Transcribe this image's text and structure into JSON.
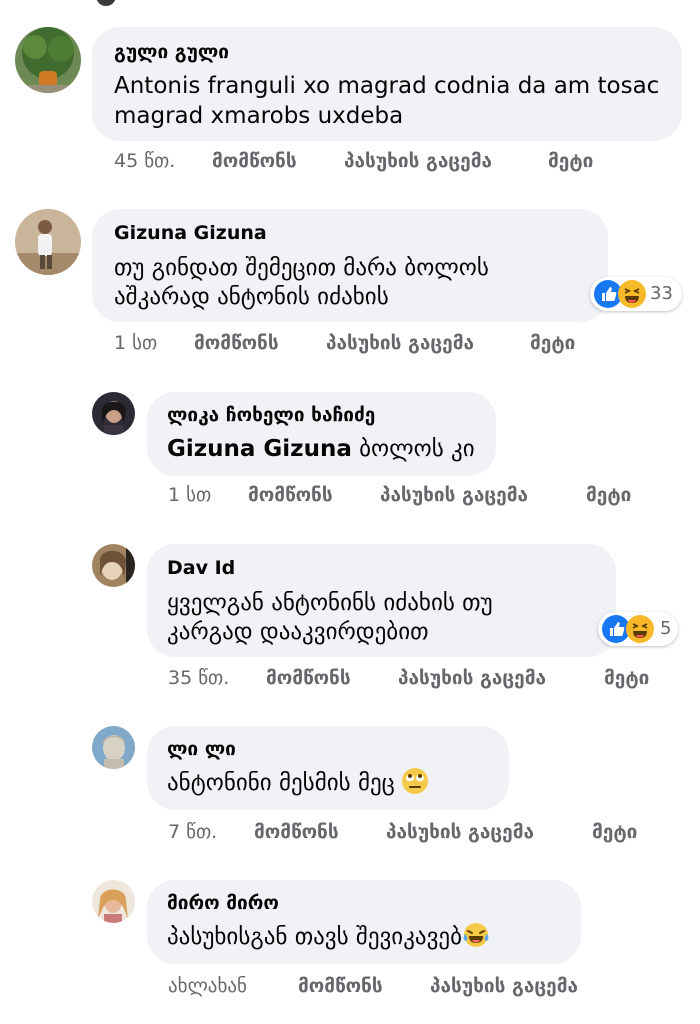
{
  "colors": {
    "bubble": "#f0f2f5",
    "meta_text": "#65676b",
    "like_blue": "#1877f2",
    "haha_yellow": "#f7b928"
  },
  "actions": {
    "like": "მომწონს",
    "reply": "პასუხის გაცემა",
    "more": "მეტი"
  },
  "comments": [
    {
      "author": "გული გული",
      "text_lines": [
        "Antonis franguli xo magrad codnia da am tosac",
        "magrad xmarobs uxdeba"
      ],
      "time": "45 წთ.",
      "avatar_icon": "avatar-tree-photo"
    },
    {
      "author": "Gizuna Gizuna",
      "text_lines": [
        "თუ გინდათ შემეცით მარა ბოლოს",
        "აშკარად ანტონის იძახის"
      ],
      "time": "1 სთ",
      "reactions": {
        "icons": [
          "like-reaction-icon",
          "haha-reaction-icon"
        ],
        "count": "33"
      },
      "avatar_icon": "avatar-person-photo"
    },
    {
      "author": "ლიკა ჩოხელი ხაჩიძე",
      "mention": "Gizuna Gizuna",
      "text_after_mention": " ბოლოს კი",
      "time": "1 სთ",
      "avatar_icon": "avatar-woman-photo"
    },
    {
      "author": "Dav Id",
      "text_lines": [
        "ყველგან ანტონინს იძახის თუ",
        "კარგად დააკვირდებით"
      ],
      "time": "35 წთ.",
      "reactions": {
        "icons": [
          "like-reaction-icon",
          "haha-reaction-icon"
        ],
        "count": "5"
      },
      "avatar_icon": "avatar-portrait-photo"
    },
    {
      "author": "ლი ლი",
      "text_lines": [
        "ანტონინი მესმის მეც"
      ],
      "emoji": "eye-roll-emoji-icon",
      "time": "7 წთ.",
      "avatar_icon": "avatar-statue-photo"
    },
    {
      "author": "მირო მირო",
      "text_lines": [
        "პასუხისგან თავს შევიკავებ"
      ],
      "emoji": "tears-of-joy-emoji-icon",
      "time": "ახლახან",
      "avatar_icon": "avatar-blonde-photo"
    }
  ]
}
